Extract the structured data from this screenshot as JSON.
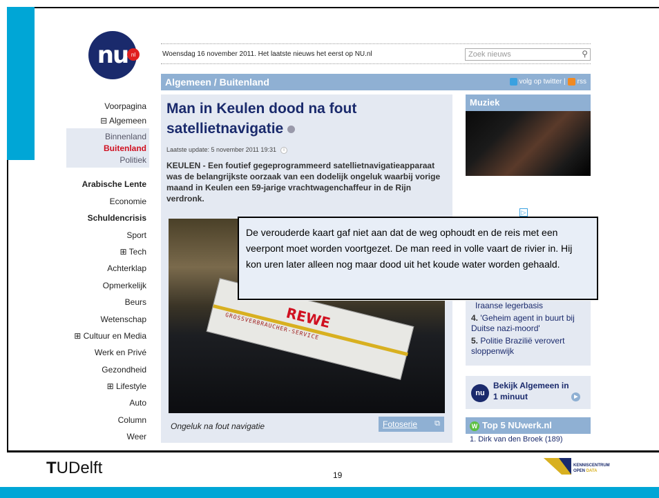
{
  "site": {
    "logo_text": "nu",
    "logo_badge": "nl",
    "date_line": "Woensdag 16 november 2011. Het laatste nieuws het eerst op NU.nl",
    "search_placeholder": "Zoek nieuws",
    "section_title": "Algemeen / Buitenland",
    "twitter_label": "volg op twitter |",
    "rss_label": "rss"
  },
  "nav": {
    "items": [
      {
        "label": "Voorpagina"
      },
      {
        "label": "⊟ Algemeen"
      }
    ],
    "sub_items": [
      {
        "label": "Binnenland"
      },
      {
        "label": "Buitenland"
      },
      {
        "label": "Politiek"
      }
    ],
    "more_items": [
      {
        "label": "Arabische Lente"
      },
      {
        "label": "Economie"
      },
      {
        "label": "Schuldencrisis"
      },
      {
        "label": "Sport"
      },
      {
        "label": "⊞ Tech"
      },
      {
        "label": "Achterklap"
      },
      {
        "label": "Opmerkelijk"
      },
      {
        "label": "Beurs"
      },
      {
        "label": "Wetenschap"
      },
      {
        "label": "⊞ Cultuur en Media"
      },
      {
        "label": "Werk en Privé"
      },
      {
        "label": "Gezondheid"
      },
      {
        "label": "⊞ Lifestyle"
      },
      {
        "label": "Auto"
      },
      {
        "label": "Column"
      },
      {
        "label": "Weer"
      }
    ]
  },
  "article": {
    "headline": "Man in Keulen dood na fout satellietnavigatie",
    "updated": "Laatste update:  5 november 2011 19:31",
    "lead": "KEULEN - Een foutief gegeprogrammeerd satellietnavigatieapparaat was de belangrijkste oorzaak van een dodelijk ongeluk waarbij vorige maand in Keulen een 59-jarige vrachtwagenchaffeur in de Rijn verdronk.",
    "photo_truck_brand": "REWE",
    "photo_truck_sub": "GROSSVERBRAUCHER-SERVICE",
    "caption": "Ongeluk na fout navigatie",
    "photos_button": "Fotoserie"
  },
  "sidebar": {
    "music_title": "Muziek",
    "ad_marker": "▷",
    "popular": [
      {
        "num": "",
        "text": "Iraanse legerbasis"
      },
      {
        "num": "4.",
        "text": "'Geheim agent in buurt bij Duitse nazi-moord'"
      },
      {
        "num": "5.",
        "text": "Politie Brazilië verovert sloppenwijk"
      }
    ],
    "minute_text": "Bekijk Algemeen in 1 minuut",
    "nuwerk_title": "Top 5 NUwerk.nl",
    "nuwerk_item": "1. Dirk van den Broek (189)"
  },
  "callout": {
    "text": "De verouderde kaart gaf niet aan dat de weg ophoudt en de reis met een veerpont moet worden voortgezet. De man reed in volle vaart de rivier in. Hij kon uren later alleen nog maar dood uit het koude water worden gehaald."
  },
  "footer": {
    "tu_logo_t": "T",
    "tu_logo_rest": "UDelft",
    "page_number": "19",
    "kc_line1": "KENNISCENTRUM",
    "kc_line2_a": "OPEN",
    "kc_line2_b": "DATA"
  },
  "colors": {
    "accent": "#00a6d6",
    "nu_blue": "#1a2a6c",
    "section_blue": "#8fb0d3",
    "active_red": "#d01020"
  }
}
